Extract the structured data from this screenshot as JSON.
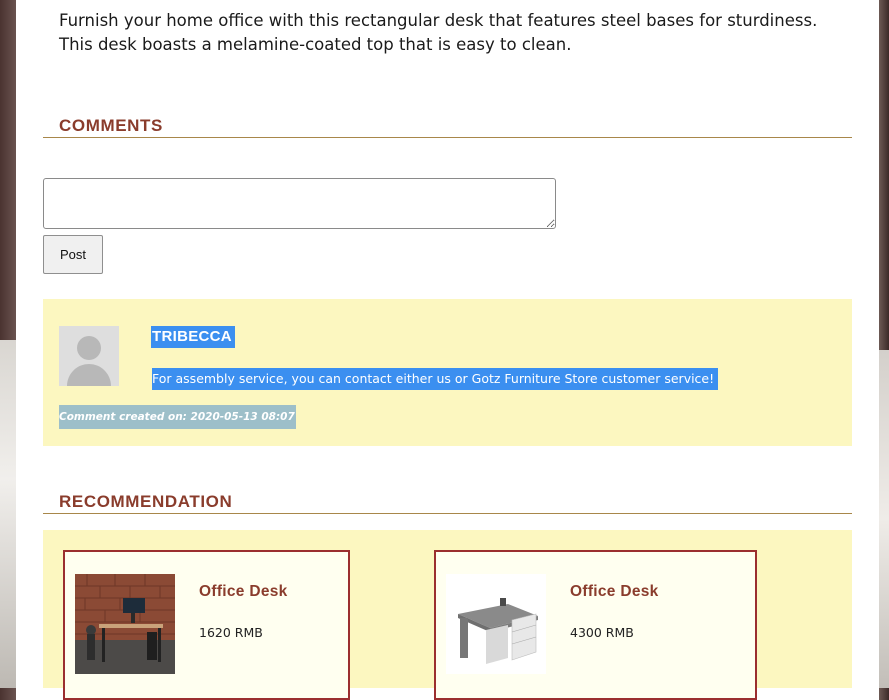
{
  "product": {
    "description": "Furnish your home office with this rectangular desk that features steel bases for sturdiness. This desk boasts a melamine-coated top that is easy to clean."
  },
  "comments": {
    "title": "COMMENTS",
    "input": {
      "value": "",
      "placeholder": ""
    },
    "post_label": "Post",
    "items": [
      {
        "author": "TRIBECCA",
        "text": "For assembly service, you can contact either us or Gotz Furniture Store customer service!",
        "created": "Comment created on: 2020-05-13 08:07"
      }
    ]
  },
  "recommendation": {
    "title": "RECOMMENDATION",
    "items": [
      {
        "name": "Office Desk",
        "price": "1620 RMB"
      },
      {
        "name": "Office Desk",
        "price": "4300 RMB"
      }
    ]
  },
  "colors": {
    "accent": "#8a3c2c",
    "rule": "#a8874a",
    "card_bg": "#fcf7c0",
    "selection": "#3b8ff0",
    "card_border": "#9b2f2f"
  },
  "icons": {
    "avatar": "default-user-avatar-icon"
  }
}
